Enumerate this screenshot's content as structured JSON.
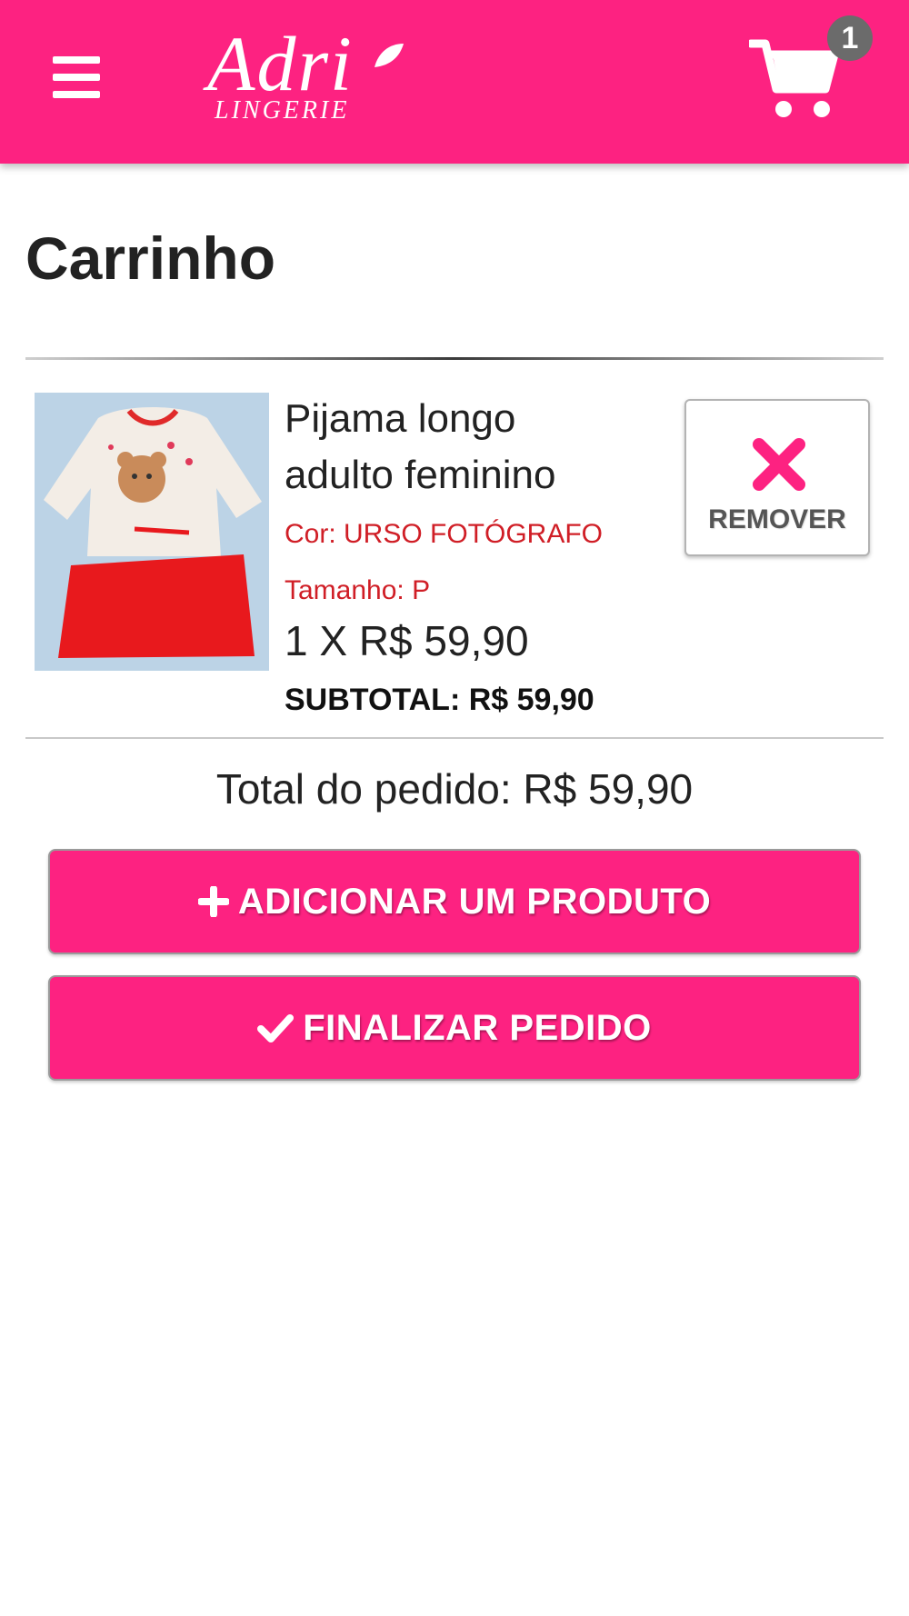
{
  "header": {
    "logo_script": "Adri",
    "logo_sub": "LINGERIE",
    "cart_count": "1",
    "colors": {
      "brand": "#fd2281",
      "badge": "#6b6b6b"
    },
    "icons": {
      "menu": "hamburger-icon",
      "cart": "cart-icon",
      "logo_leaf": "leaf-icon"
    }
  },
  "page": {
    "title": "Carrinho"
  },
  "cart": {
    "items": [
      {
        "name": "Pijama longo adulto feminino",
        "color": "Cor: URSO FOTÓGRAFO",
        "size": "Tamanho: P",
        "qty_price": "1 X R$ 59,90",
        "subtotal": "SUBTOTAL: R$ 59,90",
        "image_icon": "pajama-product-image",
        "remove_label": "REMOVER",
        "remove_icon": "close-icon"
      }
    ],
    "total": "Total do pedido: R$ 59,90",
    "variant_text_color": "#d01e26"
  },
  "actions": {
    "add_label": "ADICIONAR UM PRODUTO",
    "add_icon": "plus-icon",
    "finish_label": "FINALIZAR PEDIDO",
    "finish_icon": "check-icon"
  }
}
